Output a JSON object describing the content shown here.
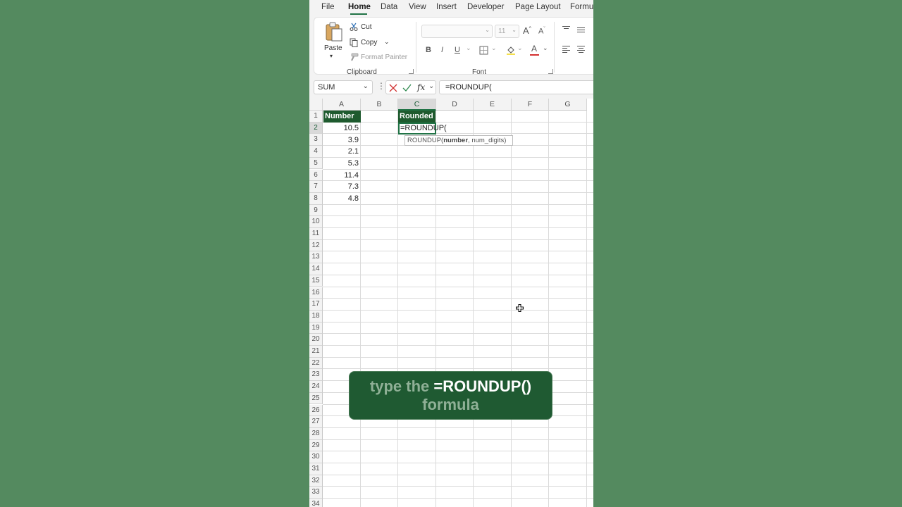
{
  "menu": {
    "tabs": [
      "File",
      "Home",
      "Data",
      "View",
      "Insert",
      "Developer",
      "Page Layout",
      "Formul"
    ],
    "active": "Home"
  },
  "ribbon": {
    "clipboard": {
      "paste": "Paste",
      "cut": "Cut",
      "copy": "Copy",
      "format_painter": "Format Painter",
      "label": "Clipboard"
    },
    "font": {
      "name": "",
      "size": "11",
      "grow": "A",
      "shrink": "A",
      "bold": "B",
      "italic": "I",
      "underline": "U",
      "font_color": "A",
      "label": "Font"
    }
  },
  "formula_bar": {
    "name_box": "SUM",
    "fx": "fx",
    "formula": "=ROUNDUP("
  },
  "grid": {
    "columns": [
      "A",
      "B",
      "C",
      "D",
      "E",
      "F",
      "G"
    ],
    "rows": [
      "1",
      "2",
      "3",
      "4",
      "5",
      "6",
      "7",
      "8",
      "9",
      "10",
      "11",
      "12",
      "13",
      "14",
      "15",
      "16",
      "17",
      "18",
      "19",
      "20",
      "21",
      "22",
      "23",
      "24",
      "25",
      "26",
      "27",
      "28",
      "29",
      "30",
      "31",
      "32",
      "33",
      "34"
    ],
    "selected_column": "C",
    "selected_row": "2",
    "a1": "Number",
    "c1": "Rounded",
    "numbers": [
      "10.5",
      "3.9",
      "2.1",
      "5.3",
      "11.4",
      "7.3",
      "4.8"
    ],
    "c2_input": "=ROUNDUP(",
    "tooltip_fn": "ROUNDUP(",
    "tooltip_arg1": "number",
    "tooltip_rest": ", num_digits)"
  },
  "caption": {
    "part1": "type the",
    "part2": "=ROUNDUP()",
    "part3": "formula"
  },
  "colors": {
    "background": "#548a5f",
    "accent": "#217346",
    "header_fill": "#1e5a2e",
    "caption_fill": "#1f5a32"
  }
}
